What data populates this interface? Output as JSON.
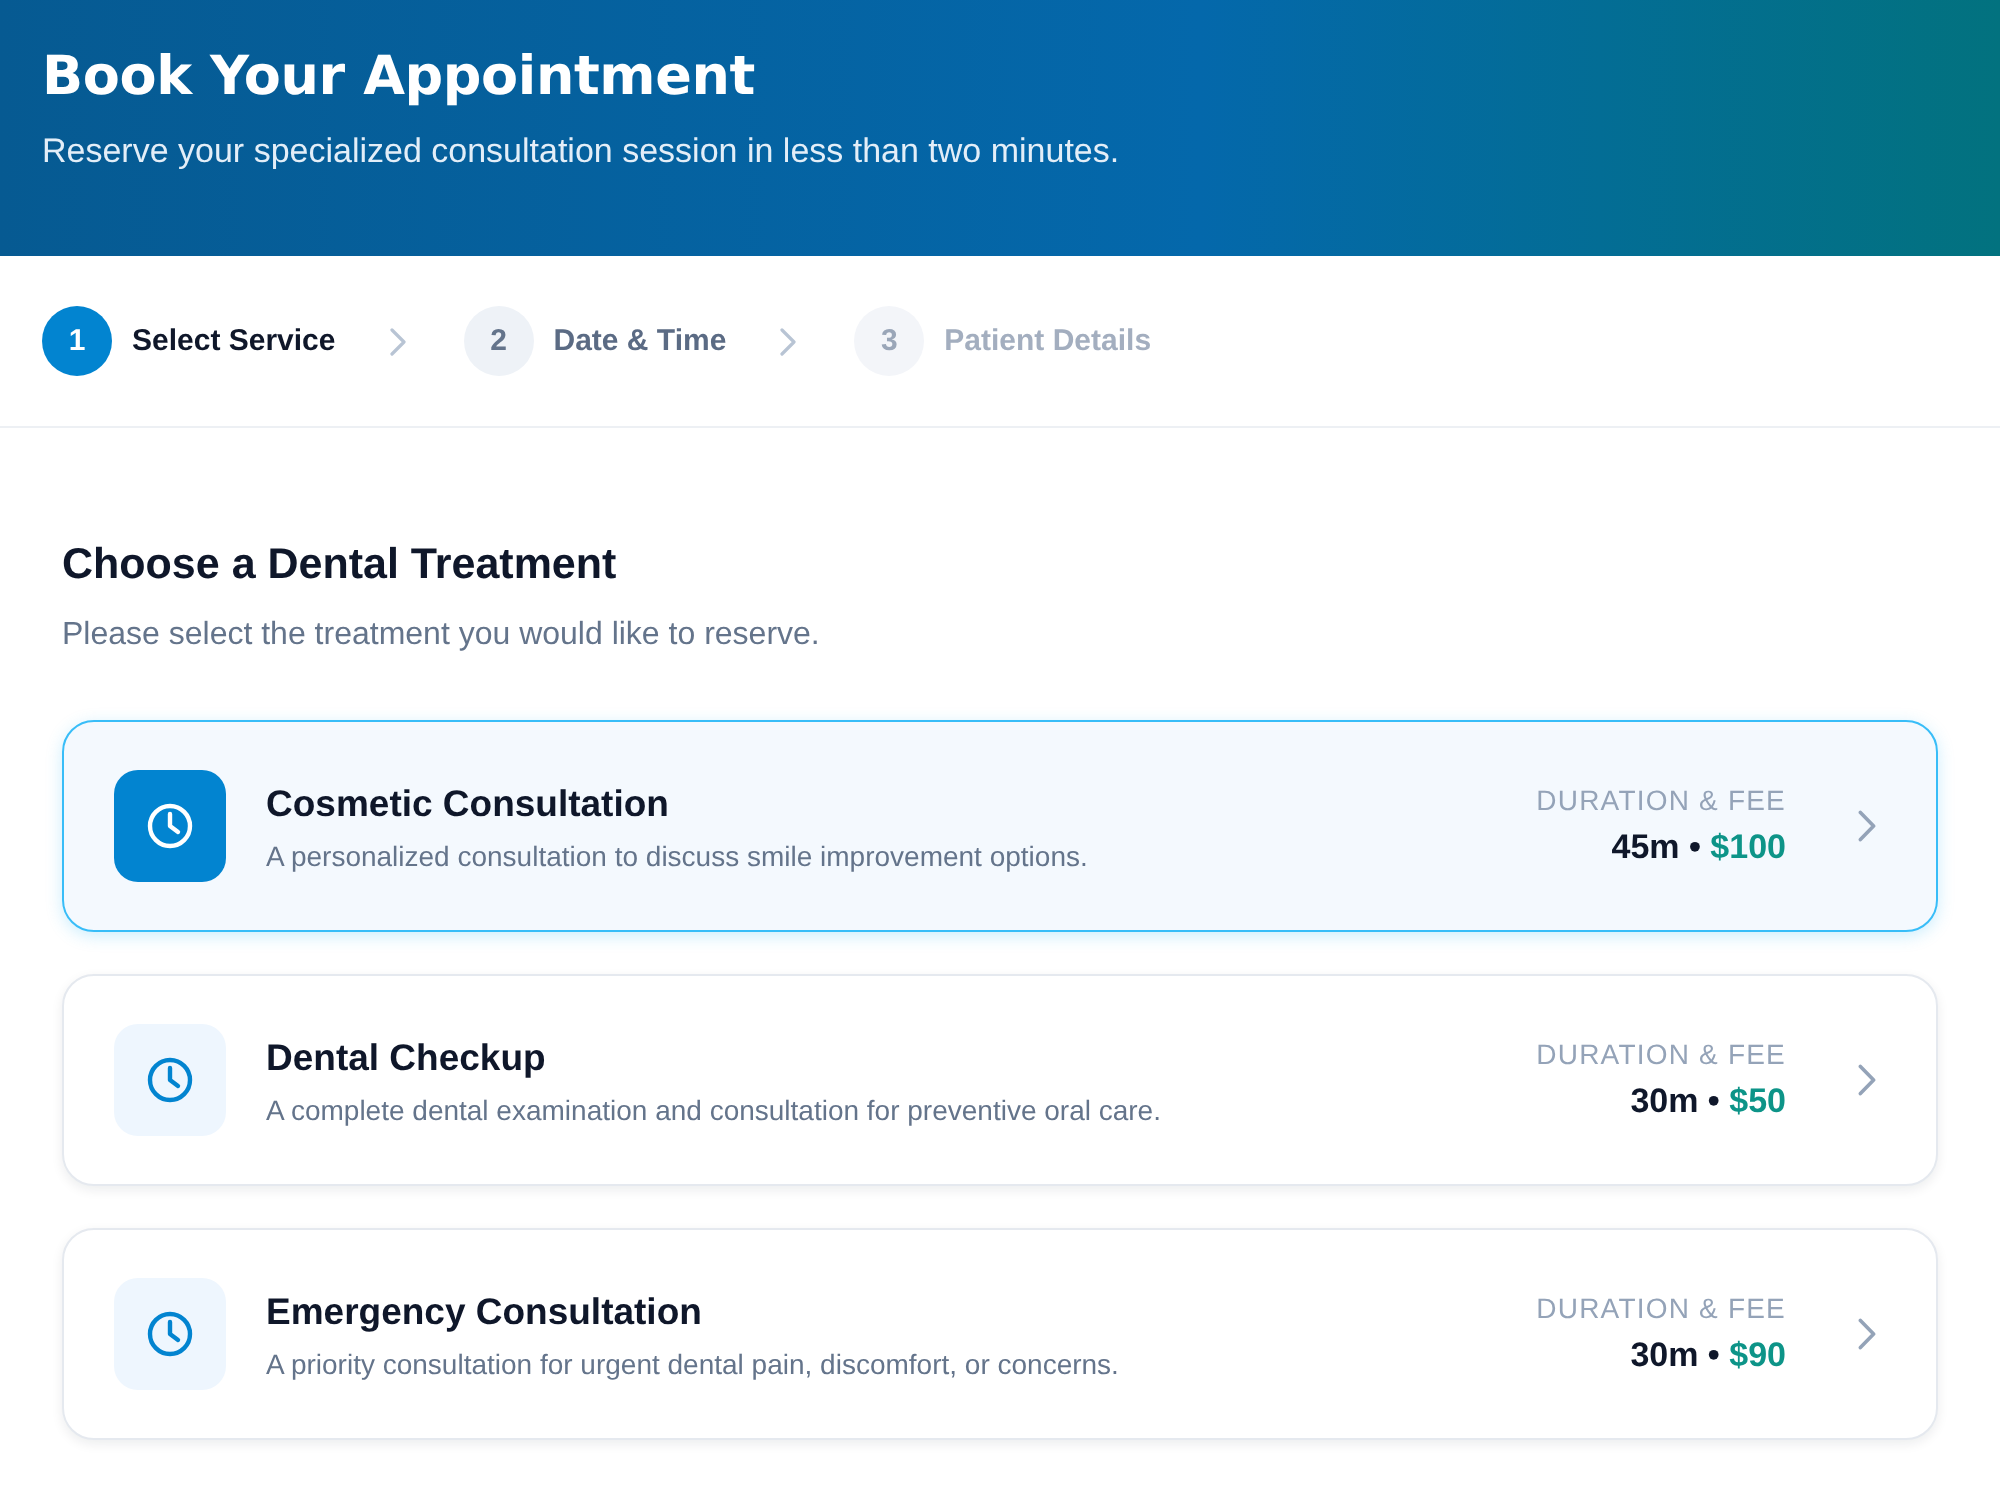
{
  "header": {
    "title": "Book Your Appointment",
    "subtitle": "Reserve your specialized consultation session in less than two minutes."
  },
  "steps": [
    {
      "number": "1",
      "label": "Select Service",
      "selected": true,
      "disabled": false
    },
    {
      "number": "2",
      "label": "Date & Time",
      "selected": false,
      "disabled": false
    },
    {
      "number": "3",
      "label": "Patient Details",
      "selected": false,
      "disabled": true
    }
  ],
  "section": {
    "title": "Choose a Dental Treatment",
    "subtitle": "Please select the treatment you would like to reserve."
  },
  "services": [
    {
      "name": "Cosmetic Consultation",
      "description": "A personalized consultation to discuss smile improvement options.",
      "meta_label": "DURATION & FEE",
      "duration": "45m",
      "separator": "•",
      "price": "$100",
      "selected": true
    },
    {
      "name": "Dental Checkup",
      "description": "A complete dental examination and consultation for preventive oral care.",
      "meta_label": "DURATION & FEE",
      "duration": "30m",
      "separator": "•",
      "price": "$50",
      "selected": false
    },
    {
      "name": "Emergency Consultation",
      "description": "A priority consultation for urgent dental pain, discomfort, or concerns.",
      "meta_label": "DURATION & FEE",
      "duration": "30m",
      "separator": "•",
      "price": "$90",
      "selected": false
    }
  ]
}
